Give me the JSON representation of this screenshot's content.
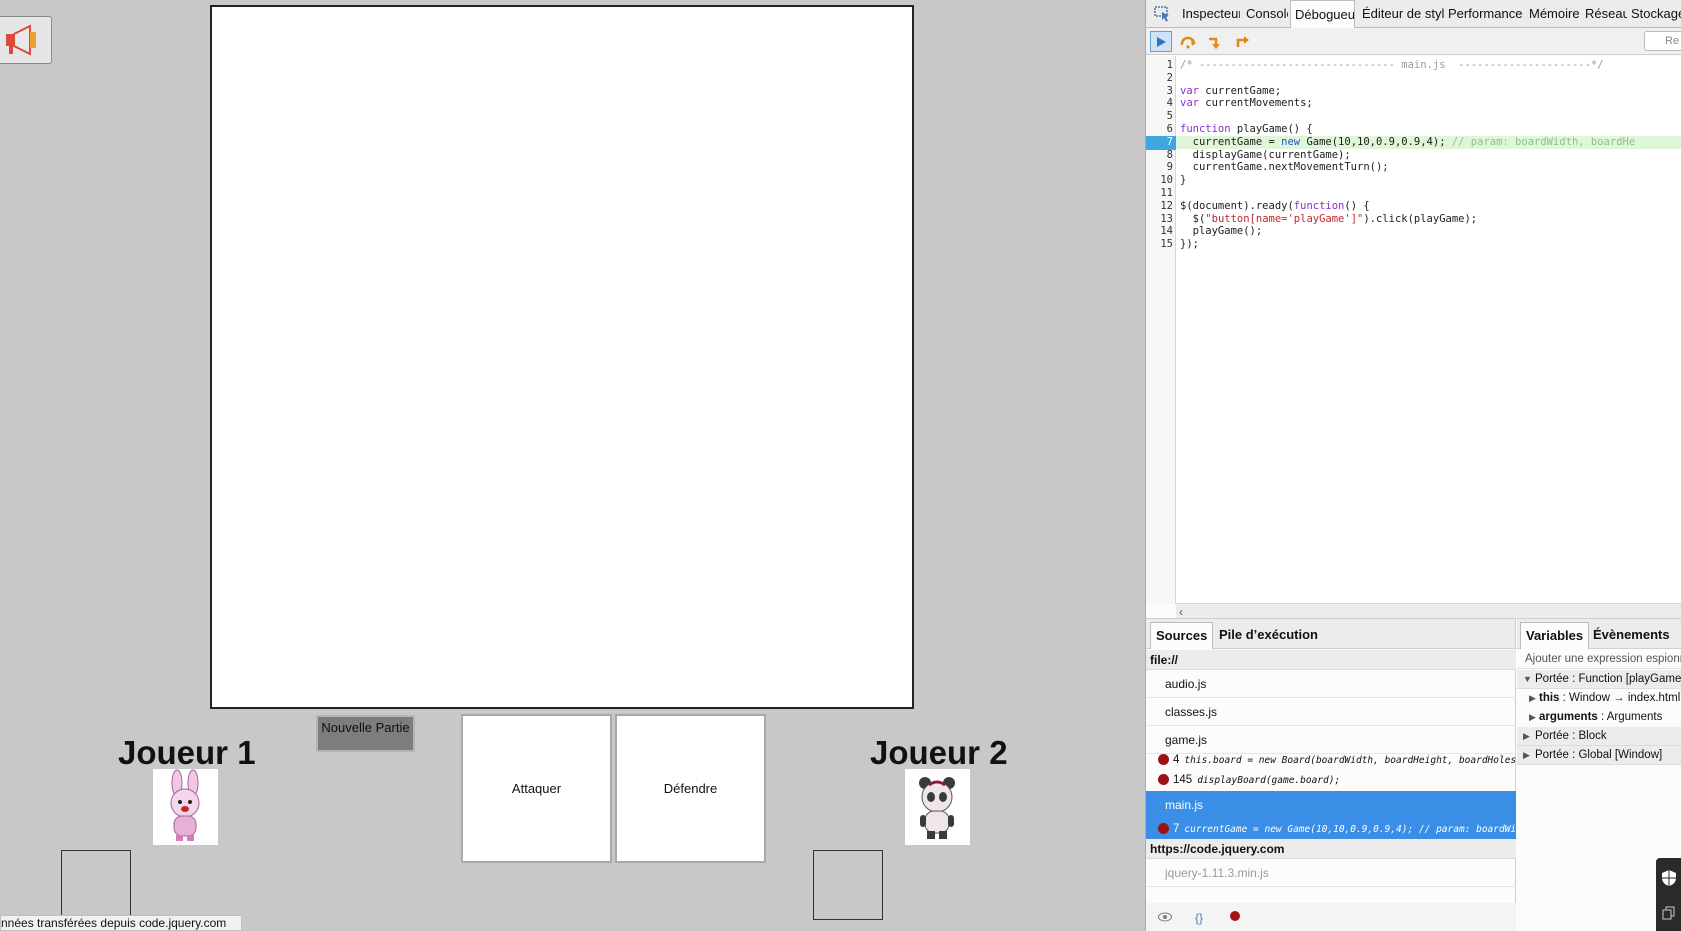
{
  "game": {
    "new_game_label": "Nouvelle Partie",
    "attack_label": "Attaquer",
    "defend_label": "Défendre",
    "player1": {
      "name": "Joueur 1"
    },
    "player2": {
      "name": "Joueur 2"
    },
    "status_text": "nnées transférées depuis code.jquery.com"
  },
  "devtools": {
    "tabs": [
      "Inspecteur",
      "Console",
      "Débogueur",
      "Éditeur de style",
      "Performance",
      "Mémoire",
      "Réseau",
      "Stockage"
    ],
    "active_tab": "Débogueur",
    "search_placeholder": "Re",
    "editor": {
      "paused_line": 7,
      "lines": [
        {
          "n": "1",
          "text": "/* ------------------------------- main.js  ---------------------*/"
        },
        {
          "n": "2",
          "text": ""
        },
        {
          "n": "3",
          "text": "var currentGame;"
        },
        {
          "n": "4",
          "text": "var currentMovements;"
        },
        {
          "n": "5",
          "text": ""
        },
        {
          "n": "6",
          "text": "function playGame() {"
        },
        {
          "n": "7",
          "text": "  currentGame = new Game(10,10,0.9,0.9,4); // param: boardWidth, boardHe"
        },
        {
          "n": "8",
          "text": "  displayGame(currentGame);"
        },
        {
          "n": "9",
          "text": "  currentGame.nextMovementTurn();"
        },
        {
          "n": "10",
          "text": "}"
        },
        {
          "n": "11",
          "text": ""
        },
        {
          "n": "12",
          "text": "$(document).ready(function() {"
        },
        {
          "n": "13",
          "text": "  $(\"button[name='playGame']\").click(playGame);"
        },
        {
          "n": "14",
          "text": "  playGame();"
        },
        {
          "n": "15",
          "text": "});"
        }
      ]
    },
    "sources": {
      "tabs": [
        "Sources",
        "Pile d’exécution"
      ],
      "groups": [
        {
          "origin": "file://",
          "files": [
            "audio.js",
            "classes.js",
            "game.js",
            "main.js"
          ]
        },
        {
          "origin": "https://code.jquery.com",
          "files": [
            "jquery-1.11.3.min.js"
          ]
        }
      ],
      "breakpoints": {
        "game_js": [
          {
            "line": "4",
            "code": "this.board = new Board(boardWidth, boardHeight, boardHoles, boardWeapons);"
          },
          {
            "line": "145",
            "code": "displayBoard(game.board);"
          }
        ],
        "main_js": [
          {
            "line": "7",
            "code": "currentGame = new Game(10,10,0.9,0.9,4); // param: boardWidth"
          }
        ]
      }
    },
    "variables": {
      "tabs": [
        "Variables",
        "Évènements"
      ],
      "watch_placeholder": "Ajouter une expression espionnée",
      "scopes": {
        "function": "Portée : Function [playGame]",
        "this_key": "this",
        "this_val": ": Window → index.html",
        "arguments_key": "arguments",
        "arguments_val": ": Arguments",
        "block": "Portée : Block",
        "global": "Portée : Global [Window]"
      }
    }
  }
}
